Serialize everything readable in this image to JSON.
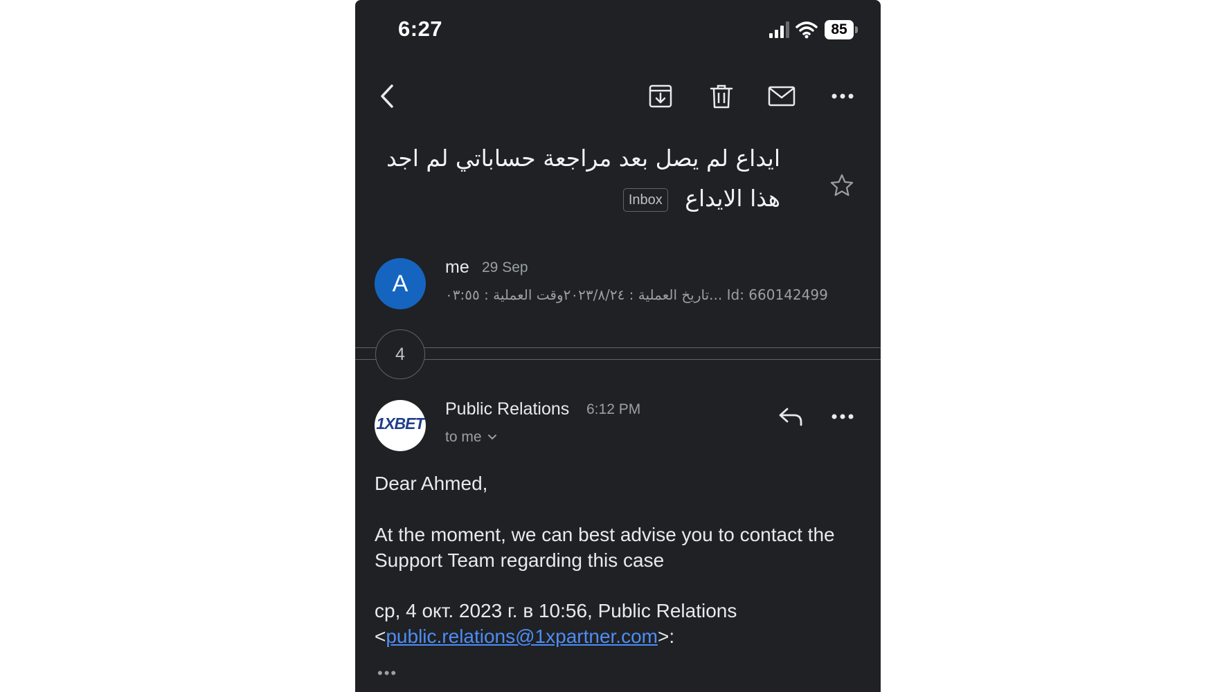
{
  "status_bar": {
    "time": "6:27",
    "battery": "85"
  },
  "toolbar": {
    "back_icon": "chevron-left-icon",
    "archive_icon": "archive-icon",
    "delete_icon": "trash-icon",
    "mark_unread_icon": "mail-icon",
    "more_icon": "more-horizontal-icon"
  },
  "email": {
    "subject": "ايداع لم يصل بعد مراجعة حساباتي لم اجد هذا الايداع",
    "label": "Inbox"
  },
  "thread": {
    "first_message": {
      "avatar_letter": "A",
      "avatar_color": "#1565c0",
      "sender": "me",
      "date": "29 Sep",
      "snippet": "تاريخ العملية : ٢٠٢٣/٨/٢٤وقت العملية : ٠٣:٥٥... Id: 660142499"
    },
    "collapsed_count": "4",
    "latest_message": {
      "avatar_logo_text": "1XBET",
      "sender": "Public Relations",
      "time": "6:12 PM",
      "recipient": "to me",
      "greeting": "Dear Ahmed,",
      "paragraph": "At the moment, we can best advise you to contact the Support Team regarding this case",
      "quote_header": "ср, 4 окт. 2023 г. в 10:56, Public Relations",
      "quote_lt": "<",
      "quote_email": "public.relations@1xpartner.com",
      "quote_gt": ">:",
      "expand_dots": "•••"
    }
  },
  "colors": {
    "background": "#202124",
    "text": "#e8eaed",
    "muted": "#9aa0a6",
    "link": "#4d8df6"
  }
}
